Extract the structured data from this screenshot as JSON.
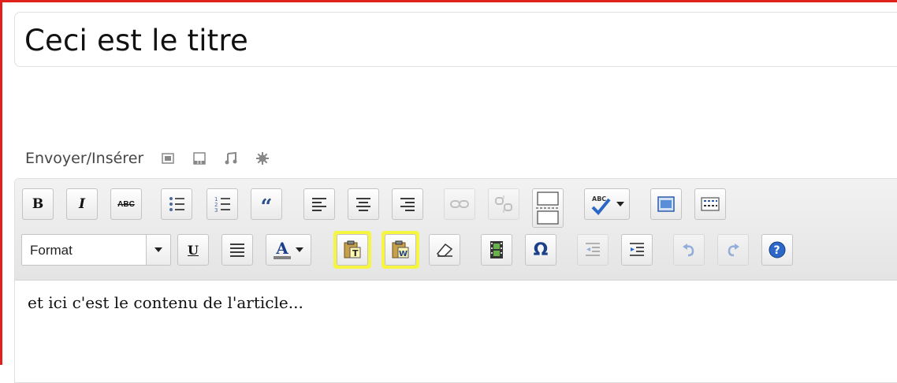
{
  "post": {
    "title": "Ceci est le titre",
    "content": "et ici c'est le contenu de l'article..."
  },
  "upload": {
    "label": "Envoyer/Insérer",
    "icons": [
      "image-icon",
      "video-icon",
      "audio-icon",
      "media-icon"
    ]
  },
  "toolbar": {
    "row1": [
      "bold",
      "italic",
      "strikethrough",
      "bullet-list",
      "numbered-list",
      "blockquote",
      "align-left",
      "align-center",
      "align-right",
      "link",
      "unlink",
      "insert-more",
      "spellcheck",
      "spellcheck-dropdown",
      "fullscreen",
      "kitchen-sink"
    ],
    "row2": [
      "format-select",
      "underline",
      "justify",
      "text-color",
      "text-color-dropdown",
      "paste-as-text",
      "paste-from-word",
      "remove-format",
      "insert-media",
      "special-character",
      "outdent",
      "indent",
      "undo",
      "redo",
      "help"
    ],
    "bold_label": "B",
    "italic_label": "I",
    "strike_label": "ABC",
    "underline_label": "U",
    "color_label": "A",
    "blockquote_label": "“",
    "omega_label": "Ω",
    "format": {
      "selected": "Format"
    },
    "highlighted": [
      "paste-as-text",
      "paste-from-word"
    ],
    "highlight_color": "#f5f542"
  },
  "colors": {
    "frame_border": "#e0201b",
    "accent_blue": "#1a63c7"
  }
}
